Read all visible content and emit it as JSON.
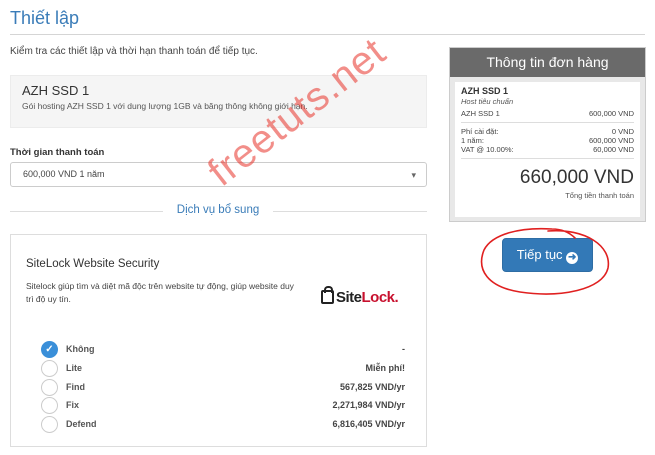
{
  "page": {
    "title": "Thiết lập",
    "intro": "Kiểm tra các thiết lập và thời hạn thanh toán để tiếp tục."
  },
  "product": {
    "name": "AZH SSD 1",
    "description": "Gói hosting AZH SSD 1 với dung lượng 1GB và băng thông không giới hạn."
  },
  "billing": {
    "label": "Thời gian thanh toán",
    "selected": "600,000 VND 1 năm"
  },
  "addons": {
    "title": "Dịch vụ bổ sung",
    "sitelock": {
      "title": "SiteLock Website Security",
      "description": "Sitelock giúp tìm và diệt mã độc trên website tự động, giúp website duy trì độ uy tín.",
      "logo_prefix": "Site",
      "logo_suffix": "Lock",
      "logo_dot": ".",
      "options": [
        {
          "name": "Không",
          "price": "-",
          "checked": true
        },
        {
          "name": "Lite",
          "price": "Miễn phí!",
          "checked": false
        },
        {
          "name": "Find",
          "price": "567,825 VND/yr",
          "checked": false
        },
        {
          "name": "Fix",
          "price": "2,271,984 VND/yr",
          "checked": false
        },
        {
          "name": "Defend",
          "price": "6,816,405 VND/yr",
          "checked": false
        }
      ]
    }
  },
  "order": {
    "header": "Thông tin đơn hàng",
    "product_name": "AZH SSD 1",
    "product_group": "Host tiêu chuẩn",
    "lines": [
      {
        "label": "AZH SSD 1",
        "value": "600,000 VND"
      }
    ],
    "fees": [
      {
        "label": "Phí cài đặt:",
        "value": "0 VND"
      },
      {
        "label": "1 năm:",
        "value": "600,000 VND"
      },
      {
        "label": "VAT @ 10.00%:",
        "value": "60,000 VND"
      }
    ],
    "total": "660,000 VND",
    "total_label": "Tổng tiền thanh toán"
  },
  "actions": {
    "continue_label": "Tiếp tục",
    "continue_icon": "arrow-circle-right-icon"
  },
  "watermark": "freetuts.net",
  "colors": {
    "accent": "#3a7cb8",
    "button": "#3379b7",
    "panel_header": "#6a6a6a",
    "annotation": "#e02020"
  }
}
